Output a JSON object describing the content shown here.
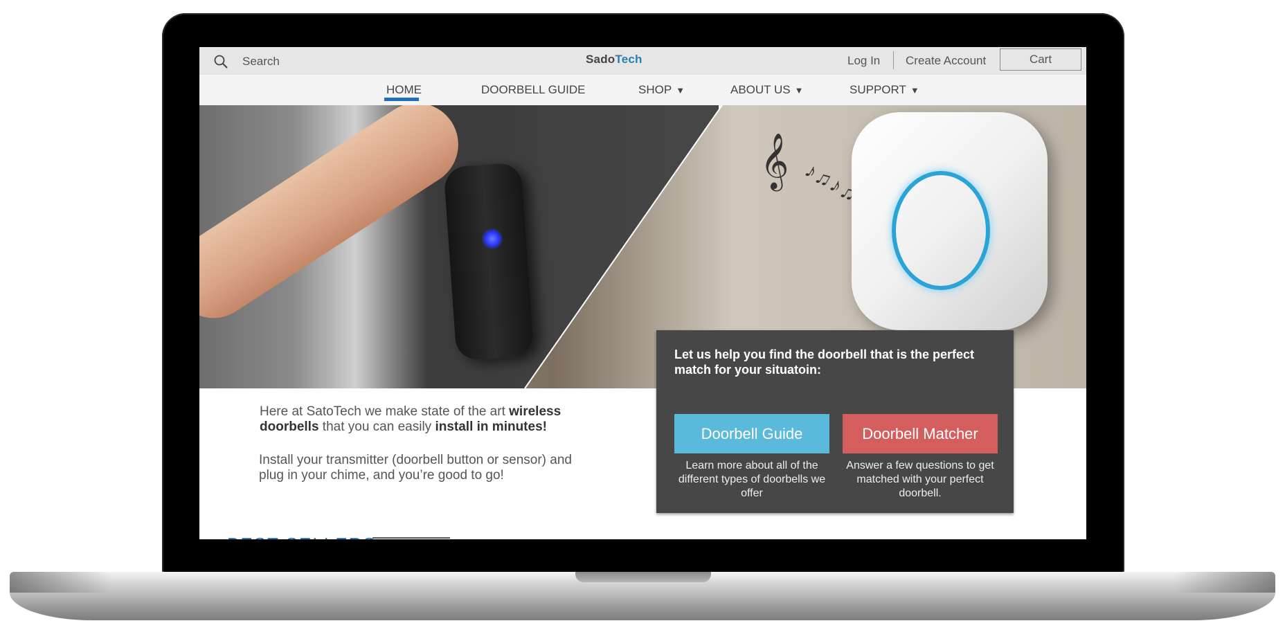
{
  "header": {
    "search_label": "Search",
    "logo_part1": "Sado",
    "logo_part2": "Tech",
    "login": "Log In",
    "create_account": "Create Account",
    "cart": "Cart"
  },
  "nav": {
    "home": "HOME",
    "doorbell_guide": "DOORBELL GUIDE",
    "shop": "SHOP",
    "about": "ABOUT US",
    "support": "SUPPORT",
    "caret": "▼"
  },
  "panel": {
    "title": "Let us help you find the doorbell that is the perfect match for your situatoin:",
    "guide_button": "Doorbell Guide",
    "matcher_button": "Doorbell Matcher",
    "guide_desc": "Learn more about all of the different types of doorbells we offer",
    "matcher_desc": "Answer a few questions to get matched with your perfect doorbell."
  },
  "intro": {
    "part1": "Here at SatoTech we make state of the art ",
    "bold1": "wireless doorbells",
    "part2": " that you can easily ",
    "bold2": "install in  minutes!"
  },
  "install_text": "Install your transmitter (doorbell button or sensor) and plug in your chime, and you’re good to go!",
  "best_sellers": "BEST SELLERS",
  "colors": {
    "accent_blue": "#2c7db5",
    "guide_button": "#5bb9dc",
    "matcher_button": "#d45e5e",
    "panel_bg": "#474747",
    "nav_active": "#1f6fc0"
  },
  "icons": [
    "search-icon",
    "caret-down-icon"
  ]
}
